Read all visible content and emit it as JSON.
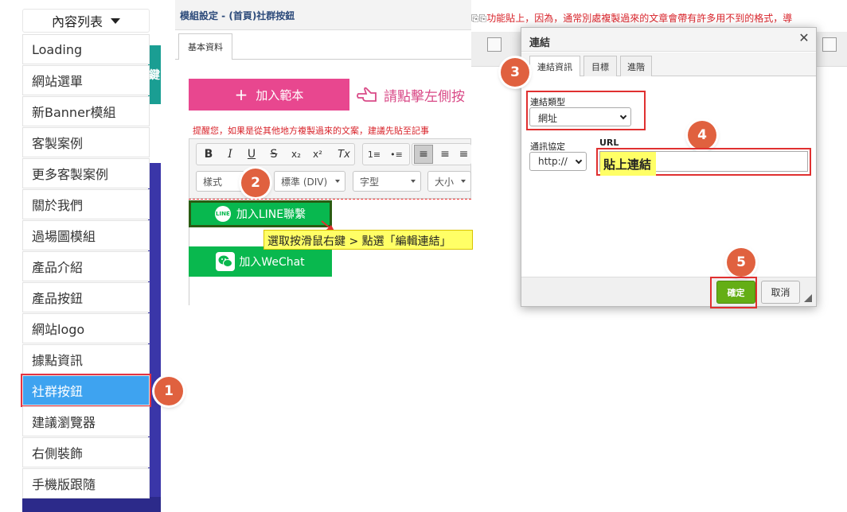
{
  "menu": {
    "title": "內容列表",
    "items": [
      "Loading",
      "網站選單",
      "新Banner模組",
      "客製案例",
      "更多客製案例",
      "關於我們",
      "過場圖模組",
      "產品介紹",
      "產品按鈕",
      "網站logo",
      "據點資訊",
      "社群按鈕",
      "建議瀏覽器",
      "右側裝飾",
      "手機版跟隨"
    ],
    "active_index": 11,
    "side_glyph": "鍵"
  },
  "editor": {
    "window_title": "模組設定 - (首頁)社群按鈕",
    "tab": "基本資料",
    "add_template": "加入範本",
    "add_icon": "+",
    "hint": "請點擊左側按",
    "warning": "提醒您，如果是從其他地方複製過來的文案，建議先貼至記事",
    "toolbar": {
      "buttons": [
        "B",
        "I",
        "U",
        "S",
        "x₂",
        "x²",
        "Tx",
        "1≡",
        "•≡",
        "≡",
        "≡",
        "≡"
      ],
      "combos": [
        "樣式",
        "標準 (DIV)",
        "字型",
        "大小"
      ]
    },
    "line_button": "加入LINE聯繫",
    "line_icon_text": "LINE",
    "wechat_button": "加入WeChat",
    "tooltip": "選取按滑鼠右鍵 > 點選「編輯連結」"
  },
  "right_top_text": "功能貼上，因為，通常別處複製過來的文章會帶有許多用不到的格式，導",
  "dialog": {
    "title": "連結",
    "close": "✕",
    "tabs": [
      "連結資訊",
      "目標",
      "進階"
    ],
    "link_type_label": "連結類型",
    "link_type_value": "網址",
    "protocol_label": "通訊協定",
    "protocol_value": "http://",
    "url_label": "URL",
    "url_value": "貼上連結",
    "ok": "確定",
    "cancel": "取消"
  },
  "steps": [
    "1",
    "2",
    "3",
    "4",
    "5"
  ],
  "colors": {
    "active_menu": "#3ea3f0",
    "badge": "#e0613f",
    "line_green": "#08b84f",
    "pink": "#e8478f",
    "ok_green": "#64ae15",
    "highlight": "#e03030"
  }
}
